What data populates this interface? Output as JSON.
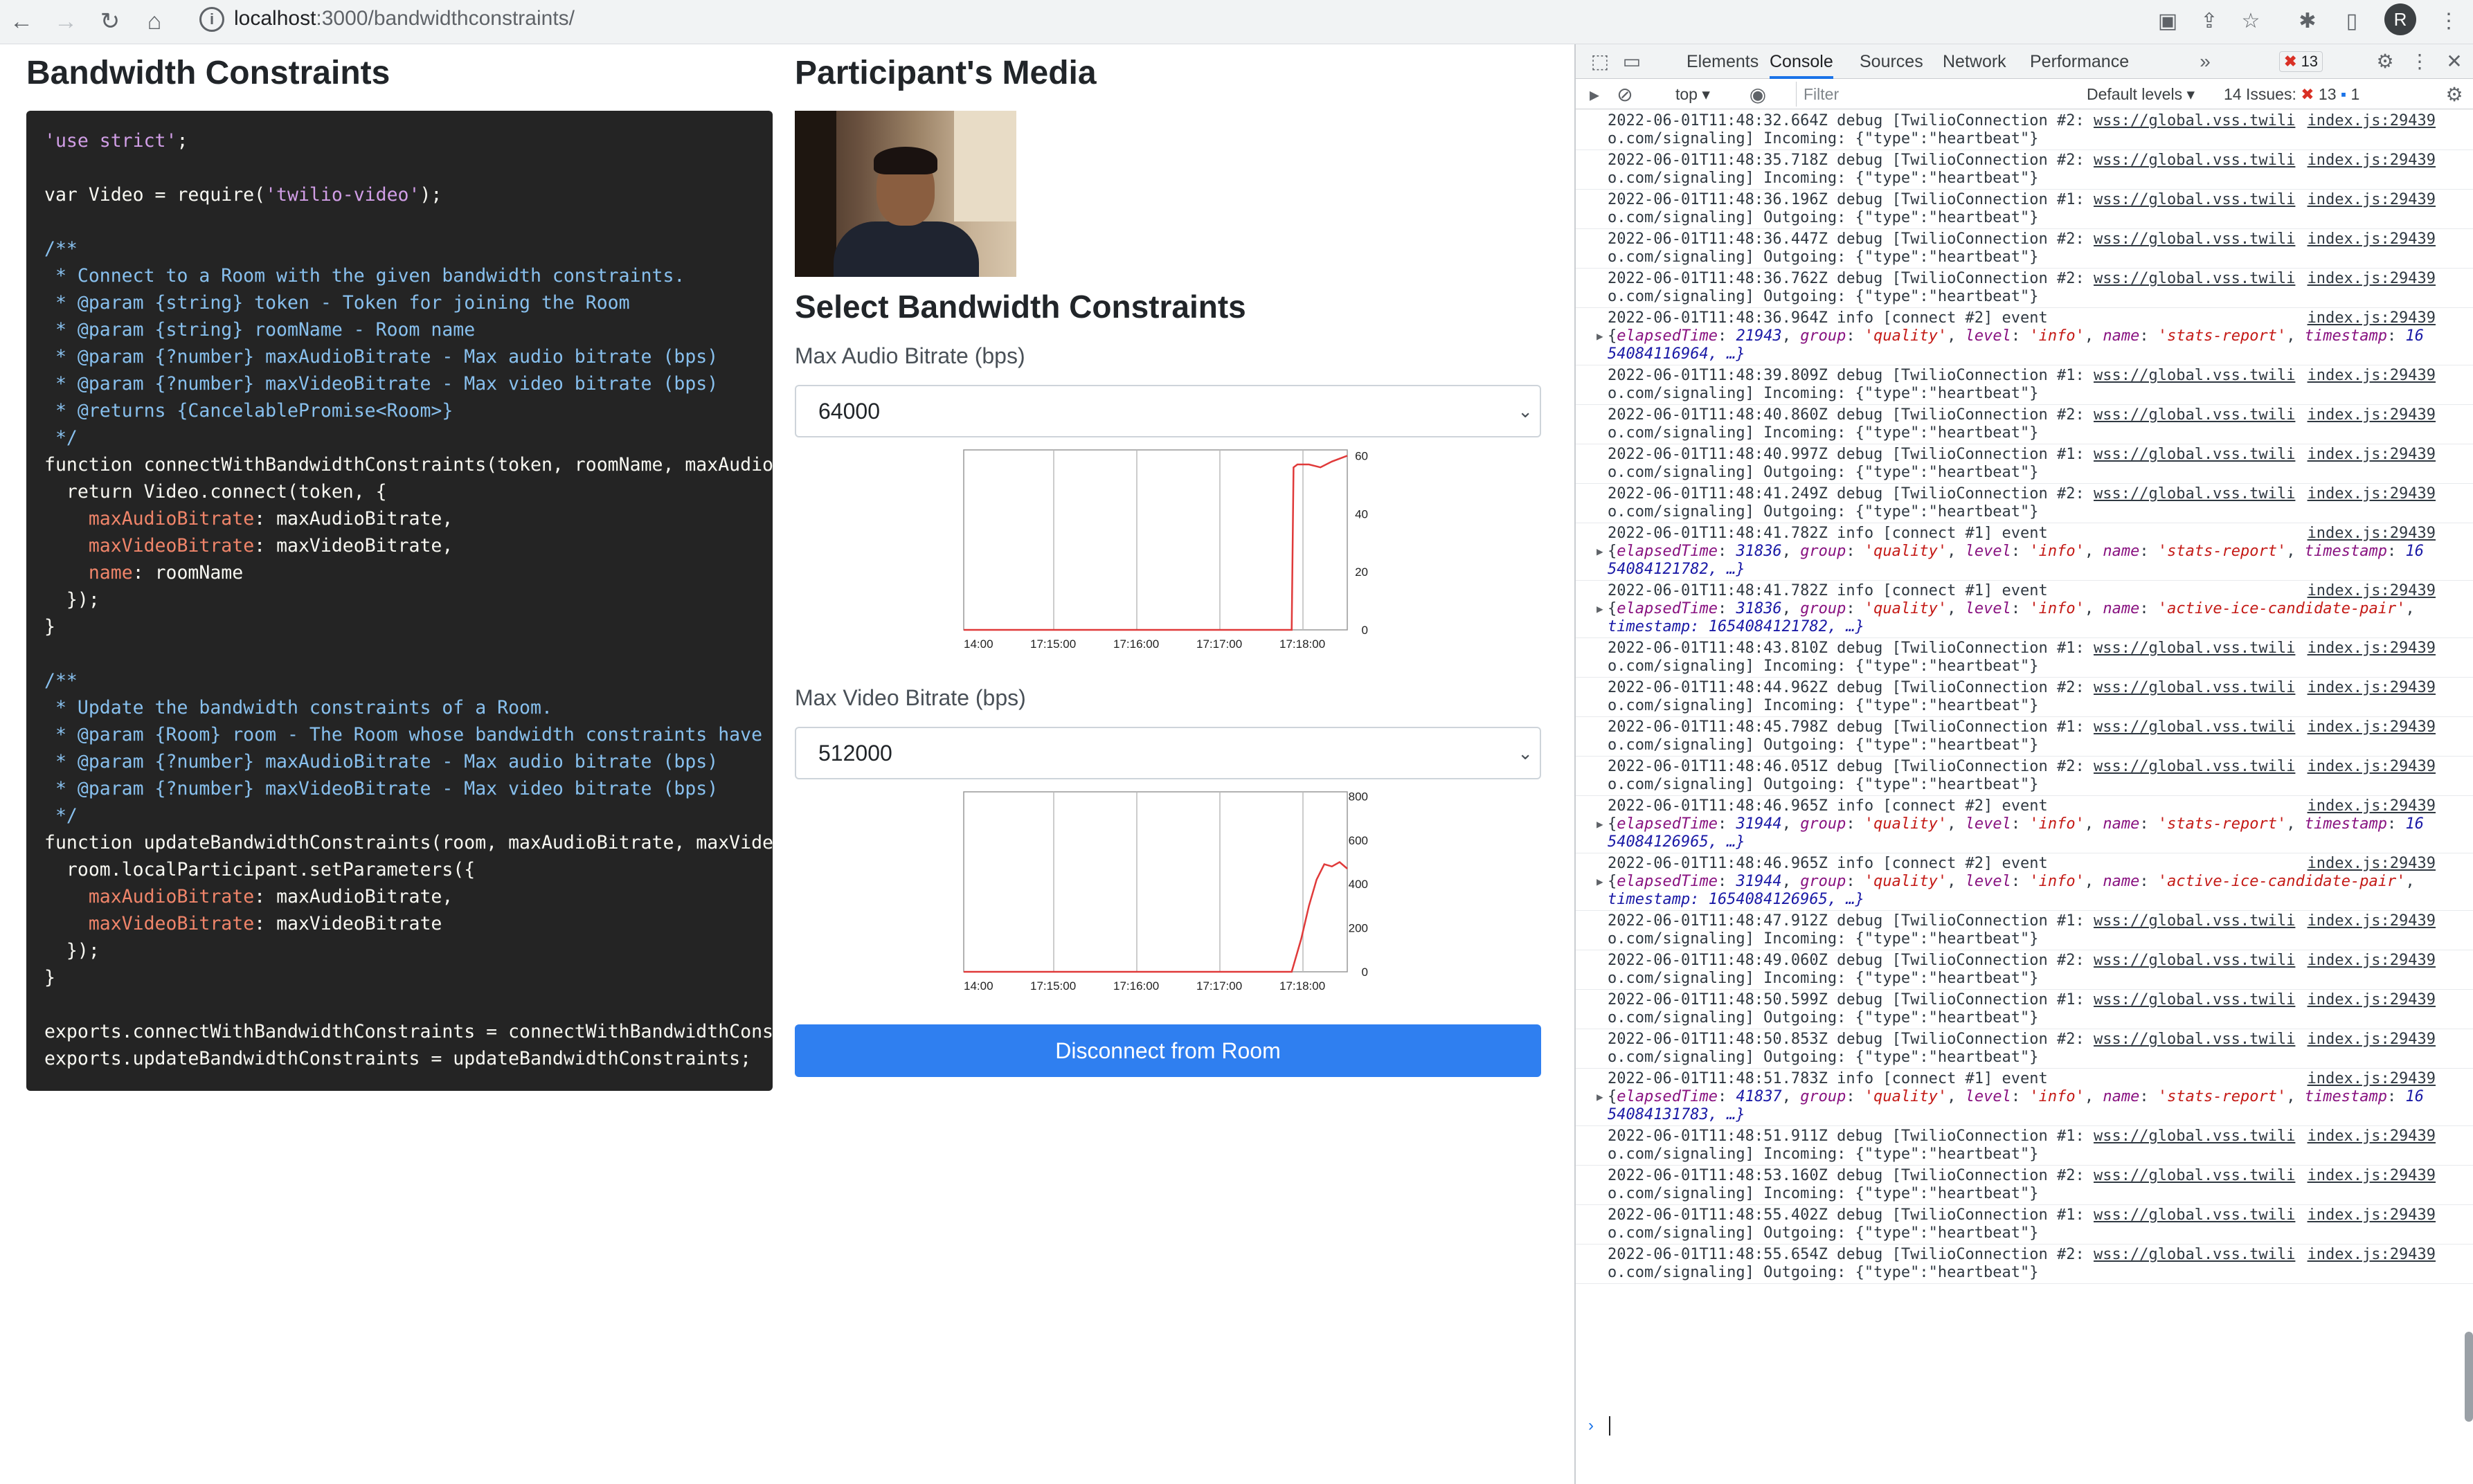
{
  "browser": {
    "url_host": "localhost",
    "url_rest": ":3000/bandwidthconstraints/",
    "profile_initial": "R"
  },
  "page": {
    "left_title": "Bandwidth Constraints",
    "right_title": "Participant's Media",
    "select_title": "Select Bandwidth Constraints",
    "audio_label": "Max Audio Bitrate (bps)",
    "audio_value": "64000",
    "video_label": "Max Video Bitrate (bps)",
    "video_value": "512000",
    "disconnect_label": "Disconnect from Room"
  },
  "code": [
    "'use strict';",
    "",
    "var Video = require('twilio-video');",
    "",
    "/**",
    " * Connect to a Room with the given bandwidth constraints.",
    " * @param {string} token - Token for joining the Room",
    " * @param {string} roomName - Room name",
    " * @param {?number} maxAudioBitrate - Max audio bitrate (bps)",
    " * @param {?number} maxVideoBitrate - Max video bitrate (bps)",
    " * @returns {CancelablePromise<Room>}",
    " */",
    "function connectWithBandwidthConstraints(token, roomName, maxAudioBi",
    "  return Video.connect(token, {",
    "    maxAudioBitrate: maxAudioBitrate,",
    "    maxVideoBitrate: maxVideoBitrate,",
    "    name: roomName",
    "  });",
    "}",
    "",
    "/**",
    " * Update the bandwidth constraints of a Room.",
    " * @param {Room} room - The Room whose bandwidth constraints have to",
    " * @param {?number} maxAudioBitrate - Max audio bitrate (bps)",
    " * @param {?number} maxVideoBitrate - Max video bitrate (bps)",
    " */",
    "function updateBandwidthConstraints(room, maxAudioBitrate, maxVideoB",
    "  room.localParticipant.setParameters({",
    "    maxAudioBitrate: maxAudioBitrate,",
    "    maxVideoBitrate: maxVideoBitrate",
    "  });",
    "}",
    "",
    "exports.connectWithBandwidthConstraints = connectWithBandwidthConstr",
    "exports.updateBandwidthConstraints = updateBandwidthConstraints;"
  ],
  "chart_data": [
    {
      "type": "line",
      "x_ticks": [
        "14:00",
        "17:15:00",
        "17:16:00",
        "17:17:00",
        "17:18:00"
      ],
      "y_ticks": [
        0,
        20,
        40,
        60
      ],
      "ylim": [
        0,
        62
      ],
      "x": [
        0,
        0.8,
        0.855,
        0.86,
        0.87,
        0.9,
        0.93,
        0.96,
        1.0
      ],
      "values": [
        0,
        0,
        0,
        56,
        57,
        57,
        56,
        58,
        60
      ],
      "color": "#e03a3a"
    },
    {
      "type": "line",
      "x_ticks": [
        "14:00",
        "17:15:00",
        "17:16:00",
        "17:17:00",
        "17:18:00"
      ],
      "y_ticks": [
        0,
        200,
        400,
        600,
        800
      ],
      "ylim": [
        0,
        820
      ],
      "x": [
        0,
        0.8,
        0.855,
        0.88,
        0.9,
        0.92,
        0.94,
        0.96,
        0.98,
        1.0
      ],
      "values": [
        0,
        0,
        0,
        150,
        300,
        420,
        490,
        480,
        500,
        470
      ],
      "color": "#e03a3a"
    }
  ],
  "devtools": {
    "tabs": [
      "Elements",
      "Console",
      "Sources",
      "Network",
      "Performance"
    ],
    "active_tab": "Console",
    "error_count": "13",
    "context": "top",
    "filter_placeholder": "Filter",
    "levels": "Default levels",
    "issues_label": "14 Issues:",
    "issues_errors": "13",
    "issues_info": "1"
  },
  "console_messages": [
    {
      "l1": "2022-06-01T11:48:32.664Z debug [TwilioConnection #2: ",
      "link": "wss://global.vss.twili",
      "l2": "o.com/signaling] Incoming: {\"type\":\"heartbeat\"}",
      "src": "index.js:29439"
    },
    {
      "l1": "2022-06-01T11:48:35.718Z debug [TwilioConnection #2: ",
      "link": "wss://global.vss.twili",
      "l2": "o.com/signaling] Incoming: {\"type\":\"heartbeat\"}",
      "src": "index.js:29439"
    },
    {
      "l1": "2022-06-01T11:48:36.196Z debug [TwilioConnection #1: ",
      "link": "wss://global.vss.twili",
      "l2": "o.com/signaling] Outgoing: {\"type\":\"heartbeat\"}",
      "src": "index.js:29439"
    },
    {
      "l1": "2022-06-01T11:48:36.447Z debug [TwilioConnection #2: ",
      "link": "wss://global.vss.twili",
      "l2": "o.com/signaling] Outgoing: {\"type\":\"heartbeat\"}",
      "src": "index.js:29439"
    },
    {
      "l1": "2022-06-01T11:48:36.762Z debug [TwilioConnection #2: ",
      "link": "wss://global.vss.twili",
      "l2": "o.com/signaling] Outgoing: {\"type\":\"heartbeat\"}",
      "src": "index.js:29439"
    },
    {
      "event": true,
      "l1": "2022-06-01T11:48:36.964Z info [connect #2] event",
      "elapsed": "21943",
      "name": "stats-report",
      "ts_tail": "16",
      "l3": "54084116964, …}",
      "src": "index.js:29439"
    },
    {
      "l1": "2022-06-01T11:48:39.809Z debug [TwilioConnection #1: ",
      "link": "wss://global.vss.twili",
      "l2": "o.com/signaling] Incoming: {\"type\":\"heartbeat\"}",
      "src": "index.js:29439"
    },
    {
      "l1": "2022-06-01T11:48:40.860Z debug [TwilioConnection #2: ",
      "link": "wss://global.vss.twili",
      "l2": "o.com/signaling] Incoming: {\"type\":\"heartbeat\"}",
      "src": "index.js:29439"
    },
    {
      "l1": "2022-06-01T11:48:40.997Z debug [TwilioConnection #1: ",
      "link": "wss://global.vss.twili",
      "l2": "o.com/signaling] Outgoing: {\"type\":\"heartbeat\"}",
      "src": "index.js:29439"
    },
    {
      "l1": "2022-06-01T11:48:41.249Z debug [TwilioConnection #2: ",
      "link": "wss://global.vss.twili",
      "l2": "o.com/signaling] Outgoing: {\"type\":\"heartbeat\"}",
      "src": "index.js:29439"
    },
    {
      "event": true,
      "l1": "2022-06-01T11:48:41.782Z info [connect #1] event",
      "elapsed": "31836",
      "name": "stats-report",
      "ts_tail": "16",
      "l3": "54084121782, …}",
      "src": "index.js:29439"
    },
    {
      "event2": true,
      "l1": "2022-06-01T11:48:41.782Z info [connect #1] event",
      "elapsed": "31836",
      "name": "active-ice-candidate-pair",
      "l3": "timestamp: 1654084121782, …}",
      "src": "index.js:29439"
    },
    {
      "l1": "2022-06-01T11:48:43.810Z debug [TwilioConnection #1: ",
      "link": "wss://global.vss.twili",
      "l2": "o.com/signaling] Incoming: {\"type\":\"heartbeat\"}",
      "src": "index.js:29439"
    },
    {
      "l1": "2022-06-01T11:48:44.962Z debug [TwilioConnection #2: ",
      "link": "wss://global.vss.twili",
      "l2": "o.com/signaling] Incoming: {\"type\":\"heartbeat\"}",
      "src": "index.js:29439"
    },
    {
      "l1": "2022-06-01T11:48:45.798Z debug [TwilioConnection #1: ",
      "link": "wss://global.vss.twili",
      "l2": "o.com/signaling] Outgoing: {\"type\":\"heartbeat\"}",
      "src": "index.js:29439"
    },
    {
      "l1": "2022-06-01T11:48:46.051Z debug [TwilioConnection #2: ",
      "link": "wss://global.vss.twili",
      "l2": "o.com/signaling] Outgoing: {\"type\":\"heartbeat\"}",
      "src": "index.js:29439"
    },
    {
      "event": true,
      "l1": "2022-06-01T11:48:46.965Z info [connect #2] event",
      "elapsed": "31944",
      "name": "stats-report",
      "ts_tail": "16",
      "l3": "54084126965, …}",
      "src": "index.js:29439"
    },
    {
      "event2": true,
      "l1": "2022-06-01T11:48:46.965Z info [connect #2] event",
      "elapsed": "31944",
      "name": "active-ice-candidate-pair",
      "l3": "timestamp: 1654084126965, …}",
      "src": "index.js:29439"
    },
    {
      "l1": "2022-06-01T11:48:47.912Z debug [TwilioConnection #1: ",
      "link": "wss://global.vss.twili",
      "l2": "o.com/signaling] Incoming: {\"type\":\"heartbeat\"}",
      "src": "index.js:29439"
    },
    {
      "l1": "2022-06-01T11:48:49.060Z debug [TwilioConnection #2: ",
      "link": "wss://global.vss.twili",
      "l2": "o.com/signaling] Incoming: {\"type\":\"heartbeat\"}",
      "src": "index.js:29439"
    },
    {
      "l1": "2022-06-01T11:48:50.599Z debug [TwilioConnection #1: ",
      "link": "wss://global.vss.twili",
      "l2": "o.com/signaling] Outgoing: {\"type\":\"heartbeat\"}",
      "src": "index.js:29439"
    },
    {
      "l1": "2022-06-01T11:48:50.853Z debug [TwilioConnection #2: ",
      "link": "wss://global.vss.twili",
      "l2": "o.com/signaling] Outgoing: {\"type\":\"heartbeat\"}",
      "src": "index.js:29439"
    },
    {
      "event": true,
      "l1": "2022-06-01T11:48:51.783Z info [connect #1] event",
      "elapsed": "41837",
      "name": "stats-report",
      "ts_tail": "16",
      "l3": "54084131783, …}",
      "src": "index.js:29439"
    },
    {
      "l1": "2022-06-01T11:48:51.911Z debug [TwilioConnection #1: ",
      "link": "wss://global.vss.twili",
      "l2": "o.com/signaling] Incoming: {\"type\":\"heartbeat\"}",
      "src": "index.js:29439"
    },
    {
      "l1": "2022-06-01T11:48:53.160Z debug [TwilioConnection #2: ",
      "link": "wss://global.vss.twili",
      "l2": "o.com/signaling] Incoming: {\"type\":\"heartbeat\"}",
      "src": "index.js:29439"
    },
    {
      "l1": "2022-06-01T11:48:55.402Z debug [TwilioConnection #1: ",
      "link": "wss://global.vss.twili",
      "l2": "o.com/signaling] Outgoing: {\"type\":\"heartbeat\"}",
      "src": "index.js:29439"
    },
    {
      "l1": "2022-06-01T11:48:55.654Z debug [TwilioConnection #2: ",
      "link": "wss://global.vss.twili",
      "l2": "o.com/signaling] Outgoing: {\"type\":\"heartbeat\"}",
      "src": "index.js:29439"
    }
  ],
  "colors": {
    "accent": "#2f7ff0",
    "code_bg": "#242424",
    "chart_line": "#e03a3a"
  }
}
